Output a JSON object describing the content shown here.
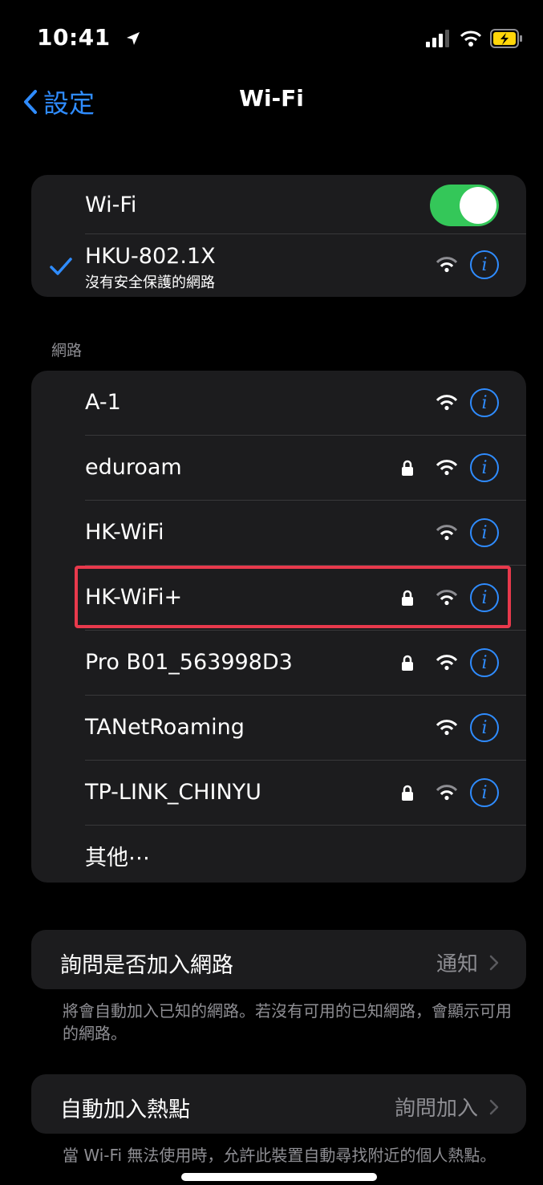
{
  "status": {
    "time": "10:41"
  },
  "nav": {
    "back_label": "設定",
    "title": "Wi-Fi"
  },
  "wifi_toggle": {
    "label": "Wi-Fi",
    "on": true
  },
  "connected": {
    "name": "HKU-802.1X",
    "subtitle": "沒有安全保護的網路"
  },
  "networks_header": "網路",
  "networks": [
    {
      "name": "A-1",
      "locked": false
    },
    {
      "name": "eduroam",
      "locked": true
    },
    {
      "name": "HK-WiFi",
      "locked": false
    },
    {
      "name": "HK-WiFi+",
      "locked": true
    },
    {
      "name": "Pro B01_563998D3",
      "locked": true
    },
    {
      "name": "TANetRoaming",
      "locked": false
    },
    {
      "name": "TP-LINK_CHINYU",
      "locked": true
    }
  ],
  "other_label": "其他⋯",
  "ask_join": {
    "label": "詢問是否加入網路",
    "value": "通知",
    "footer": "將會自動加入已知的網路。若沒有可用的已知網路，會顯示可用的網路。"
  },
  "auto_hotspot": {
    "label": "自動加入熱點",
    "value": "詢問加入",
    "footer": "當 Wi-Fi 無法使用時，允許此裝置自動尋找附近的個人熱點。"
  },
  "colors": {
    "accent": "#2f8cff",
    "toggle_on": "#34c759",
    "highlight": "#e8394c",
    "cell": "#1c1c1e"
  },
  "icons": {
    "wifi": "wifi-icon",
    "lock": "lock-icon",
    "info": "info-icon",
    "check": "checkmark-icon",
    "chevron": "chevron-right-icon"
  }
}
